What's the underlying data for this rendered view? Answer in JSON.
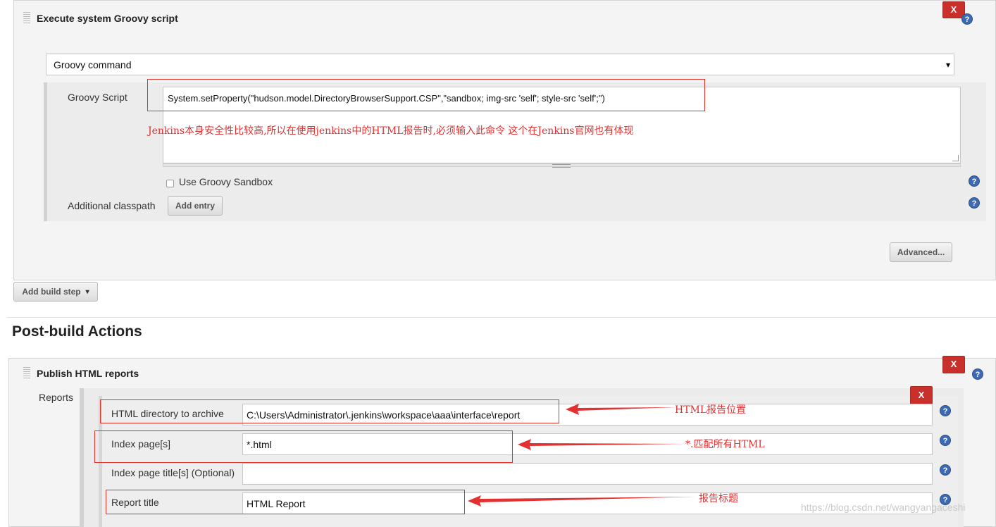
{
  "groovy": {
    "title": "Execute system Groovy script",
    "close_label": "X",
    "select_value": "Groovy command",
    "script_label": "Groovy Script",
    "script_text": "System.setProperty(\"hudson.model.DirectoryBrowserSupport.CSP\",\"sandbox; img-src 'self'; style-src 'self';\")",
    "sandbox_label": "Use Groovy Sandbox",
    "classpath_label": "Additional classpath",
    "add_entry_label": "Add entry",
    "advanced_label": "Advanced..."
  },
  "add_build_step_label": "Add build step",
  "post_build": {
    "heading": "Post-build Actions",
    "publish_title": "Publish HTML reports",
    "close_label": "X",
    "reports_label": "Reports",
    "report_close_label": "X",
    "fields": [
      {
        "label": "HTML directory to archive",
        "value": "C:\\Users\\Administrator\\.jenkins\\workspace\\aaa\\interface\\report"
      },
      {
        "label": "Index page[s]",
        "value": "*.html"
      },
      {
        "label": "Index page title[s] (Optional)",
        "value": ""
      },
      {
        "label": "Report title",
        "value": "HTML Report"
      }
    ]
  },
  "annotations": {
    "csp_note": "Jenkins本身安全性比较高,所以在使用jenkins中的HTML报告时,必须输入此命令 这个在Jenkins官网也有体现",
    "dir_note": "HTML报告位置",
    "index_note": "*.匹配所有HTML",
    "title_note": "报告标题"
  },
  "watermark": "https://blog.csdn.net/wangyangaceshi",
  "icons": {
    "help": "?",
    "dropdown": "▾",
    "caret": "▾"
  },
  "colors": {
    "close": "#c9302c",
    "annotation": "#e33030",
    "help": "#3d6ab3"
  }
}
